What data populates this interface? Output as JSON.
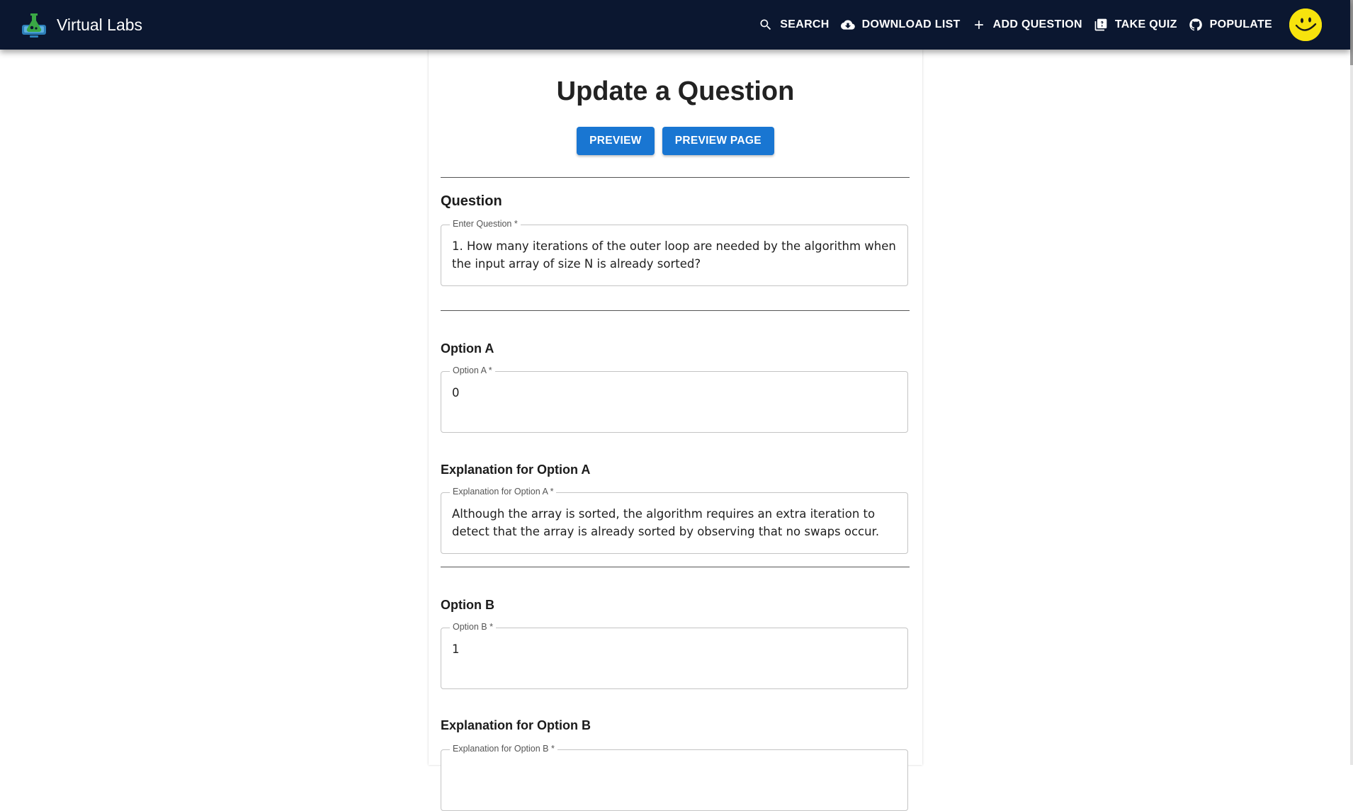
{
  "app": {
    "title": "Virtual Labs",
    "nav": [
      {
        "label": "SEARCH",
        "icon": "search-icon"
      },
      {
        "label": "DOWNLOAD LIST",
        "icon": "cloud-download-icon"
      },
      {
        "label": "ADD QUESTION",
        "icon": "plus-icon"
      },
      {
        "label": "TAKE QUIZ",
        "icon": "quiz-icon"
      },
      {
        "label": "POPULATE",
        "icon": "github-icon"
      }
    ],
    "colors": {
      "appbar": "#0b1730",
      "primary": "#1976d2",
      "avatar": "#f7e30d"
    }
  },
  "page": {
    "title": "Update a Question",
    "buttons": {
      "preview": "PREVIEW",
      "preview_page": "PREVIEW PAGE"
    }
  },
  "question": {
    "section_label": "Question",
    "field_label": "Enter Question *",
    "value": "1. How many iterations of the outer loop are needed by the algorithm when the input array of size N is already sorted?"
  },
  "options": [
    {
      "section_label": "Option A",
      "field_label": "Option A *",
      "value": "0",
      "explanation_section_label": "Explanation for Option A",
      "explanation_field_label": "Explanation for Option A *",
      "explanation": "Although the array is sorted, the algorithm requires an extra iteration to detect that the array is already sorted by observing that no swaps occur."
    },
    {
      "section_label": "Option B",
      "field_label": "Option B *",
      "value": "1",
      "explanation_section_label": "Explanation for Option B",
      "explanation_field_label": "Explanation for Option B *",
      "explanation": ""
    }
  ]
}
